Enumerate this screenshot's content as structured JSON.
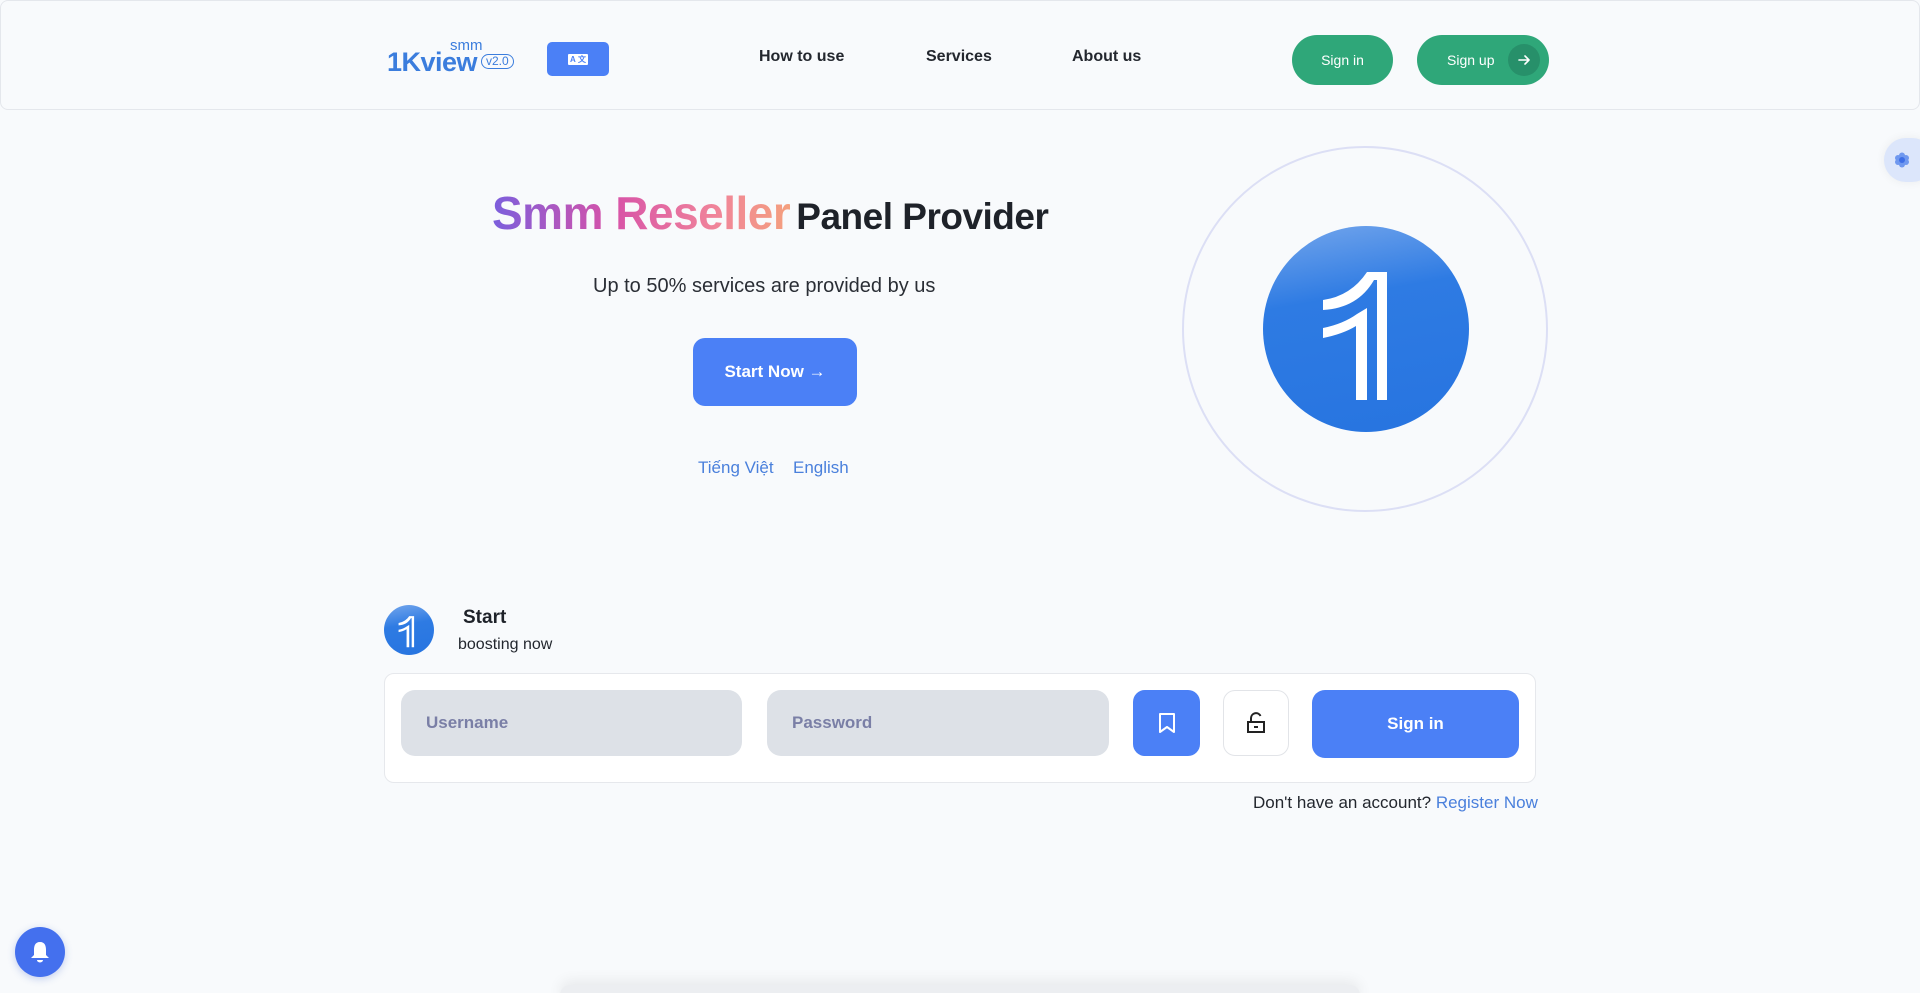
{
  "header": {
    "brand": "1Kview",
    "brand_sup": "smm",
    "version": "v2.0",
    "translate_icon": "translate-icon",
    "nav": [
      {
        "label": "How to use"
      },
      {
        "label": "Services"
      },
      {
        "label": "About us"
      }
    ],
    "signin_label": "Sign in",
    "signup_label": "Sign up",
    "signup_icon": "arrow-right-icon"
  },
  "side_tab": {
    "icon": "gear-icon"
  },
  "hero": {
    "title_highlight": "Smm Reseller",
    "title_rest": "Panel Provider",
    "subtitle": "Up to 50% services are provided by us",
    "cta_label": "Start Now →",
    "languages": [
      {
        "label": "Tiếng Việt"
      },
      {
        "label": "English"
      }
    ],
    "logo_icon": "1kview-logo"
  },
  "login": {
    "title": "Start",
    "subtitle": "boosting now",
    "username_placeholder": "Username",
    "username_value": "",
    "password_placeholder": "Password",
    "password_value": "",
    "bookmark_icon": "bookmark-icon",
    "lock_icon": "unlock-icon",
    "signin_label": "Sign in",
    "register_prompt": "Don't have an account?",
    "register_link": "Register Now"
  },
  "notifications": {
    "icon": "bell-icon"
  },
  "colors": {
    "primary": "#4b80f6",
    "green": "#2fa779",
    "link": "#4a80dc",
    "logo_blue": "#2774e0"
  }
}
